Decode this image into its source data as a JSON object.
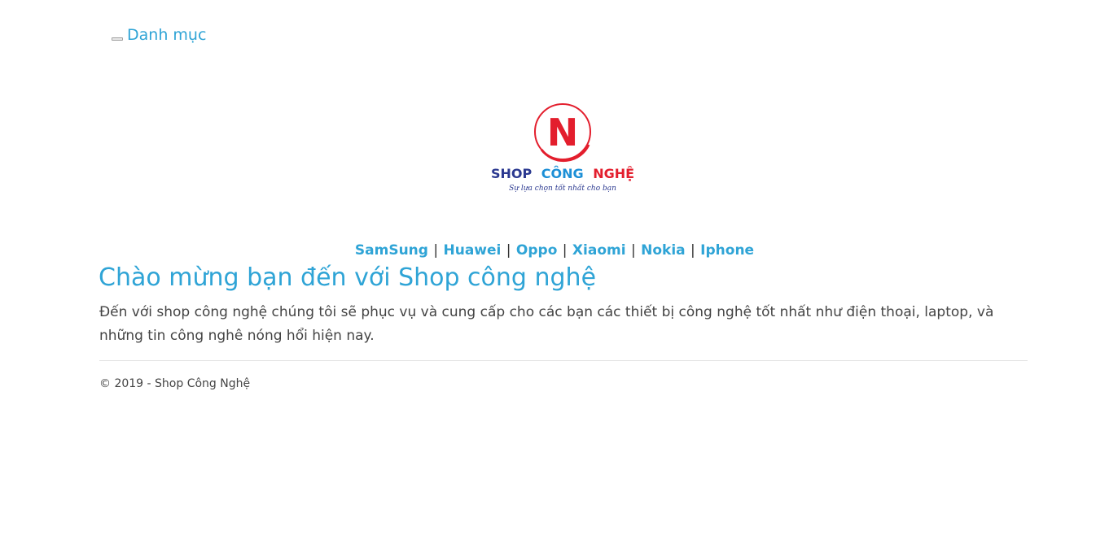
{
  "menu": {
    "label": "Danh mục"
  },
  "logo": {
    "letter": "N",
    "word1": "SHOP",
    "word2": "CÔNG",
    "word3": "NGHỆ",
    "tagline": "Sự lựa chọn tốt nhất cho bạn",
    "colors": {
      "red": "#e31e2d",
      "blue": "#2b3990",
      "accent_blue": "#1c8fd6"
    }
  },
  "brands": {
    "items": [
      "SamSung",
      "Huawei",
      "Oppo",
      "Xiaomi",
      "Nokia",
      "Iphone"
    ],
    "separator": "|"
  },
  "main": {
    "title": "Chào mừng bạn đến với Shop công nghệ",
    "description": "Đến với shop công nghệ chúng tôi sẽ phục vụ và cung cấp cho các bạn các thiết bị công nghệ tốt nhất như điện thoại, laptop, và những tin công nghê nóng hổi hiện nay."
  },
  "footer": {
    "copyright": "© 2019 - Shop Công Nghệ"
  },
  "colors": {
    "link": "#2fa4d6",
    "text": "#444444"
  }
}
